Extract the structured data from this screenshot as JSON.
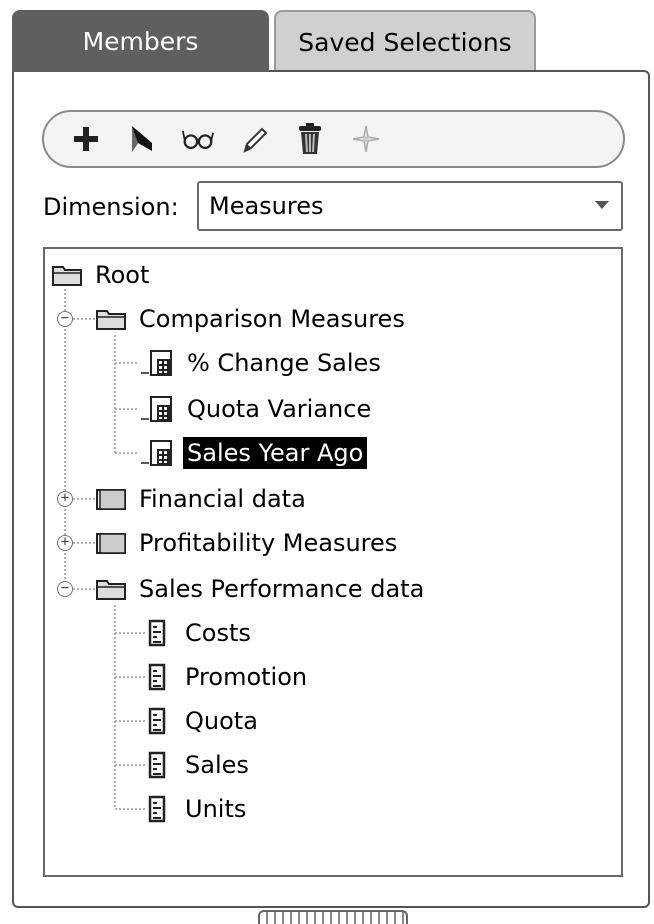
{
  "tabs": [
    {
      "label": "Members",
      "active": true
    },
    {
      "label": "Saved Selections",
      "active": false
    }
  ],
  "toolbar": {
    "tools": [
      {
        "name": "add-icon",
        "enabled": true
      },
      {
        "name": "select-arrow-icon",
        "enabled": true
      },
      {
        "name": "view-glasses-icon",
        "enabled": true
      },
      {
        "name": "edit-pencil-icon",
        "enabled": true
      },
      {
        "name": "delete-trash-icon",
        "enabled": true
      },
      {
        "name": "sparkle-icon",
        "enabled": false
      }
    ]
  },
  "dimension": {
    "label": "Dimension:",
    "selected": "Measures"
  },
  "tree": {
    "root": "Root",
    "comparison": {
      "label": "Comparison Measures",
      "children": [
        "% Change Sales",
        "Quota Variance",
        "Sales Year Ago"
      ]
    },
    "financial": "Financial data",
    "profitability": "Profitability Measures",
    "sales_perf": {
      "label": "Sales Performance data",
      "children": [
        "Costs",
        "Promotion",
        "Quota",
        "Sales",
        "Units"
      ]
    },
    "selected_item": "Sales Year Ago"
  }
}
